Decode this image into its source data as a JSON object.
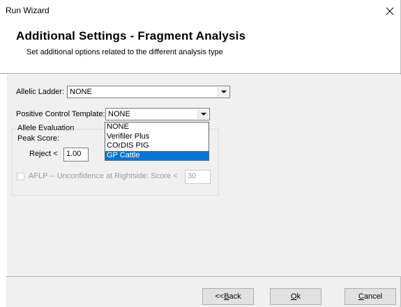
{
  "window": {
    "title": "Run Wizard",
    "close_glyph": "✕"
  },
  "header": {
    "title": "Additional Settings - Fragment Analysis",
    "subtitle": "Set additional options related to the different analysis type"
  },
  "form": {
    "allelic_ladder_label": "Allelic Ladder:",
    "allelic_ladder_value": "NONE",
    "positive_control_label": "Positive Control Template:",
    "positive_control_value": "NONE",
    "positive_control_options": [
      "NONE",
      "Verifiler Plus",
      "COrDIS PIG",
      "GP Cattle"
    ],
    "positive_control_highlighted": "GP Cattle",
    "allele_evaluation": {
      "group_title": "Allele Evaluation",
      "peak_score_label": "Peak Score:",
      "reject_label": "Reject <",
      "reject_value": "1.00"
    },
    "aflp": {
      "checked": false,
      "label": "AFLP -- Unconfidence at Rightside:  Score <",
      "value": "30"
    }
  },
  "footer": {
    "back_prefix": "<< ",
    "back_mnemonic": "B",
    "back_rest": "ack",
    "ok_mnemonic": "O",
    "ok_rest": "k",
    "cancel_mnemonic": "C",
    "cancel_rest": "ancel"
  },
  "colors": {
    "selection": "#0078d7",
    "panel_bg": "#f0f0f0",
    "disabled_text": "#9a9a9a"
  },
  "icons": {
    "close": "close-icon",
    "combo_arrow": "chevron-down-icon"
  }
}
